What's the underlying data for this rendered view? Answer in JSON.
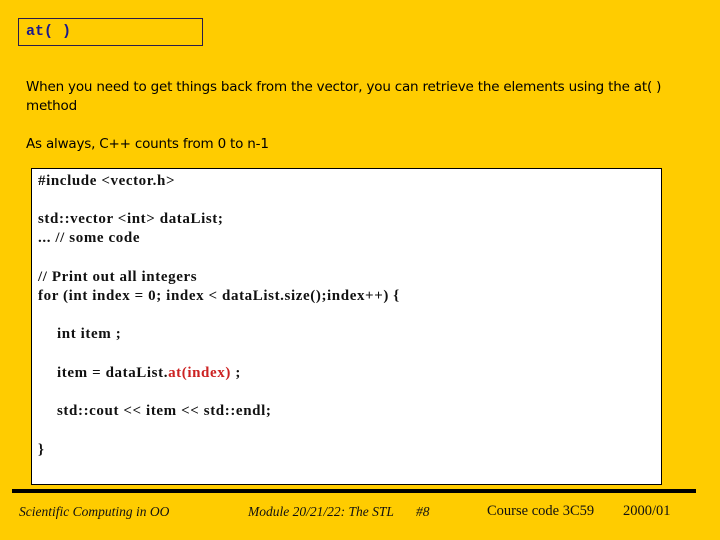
{
  "slide": {
    "title": "at( )",
    "paragraphs": [
      "When you need to get things back from the vector, you can retrieve the elements using the at( ) method",
      "As always, C++ counts from 0 to n-1"
    ]
  },
  "code": {
    "lines": {
      "include": "#include <vector.h>",
      "declare": "std::vector <int> dataList;",
      "some_code": "... // some code",
      "comment": "// Print out all integers",
      "for_loop": "for (int index = 0; index < dataList.size();index++) {",
      "int_item": "int item ;",
      "assign_prefix": "item = dataList.",
      "assign_highlight": "at(index)",
      "assign_suffix": " ;",
      "cout": "std::cout << item << std::endl;",
      "close_brace": "}"
    },
    "highlight_color": "#cc2222"
  },
  "footer": {
    "course_name": "Scientific Computing in OO",
    "module": "Module 20/21/22: The STL",
    "slide_number": "#8",
    "course_code": "Course code 3C59",
    "year": "2000/01"
  },
  "colors": {
    "background": "#ffcc00",
    "title_text": "#1a1a8c",
    "code_background": "#ffffff"
  }
}
